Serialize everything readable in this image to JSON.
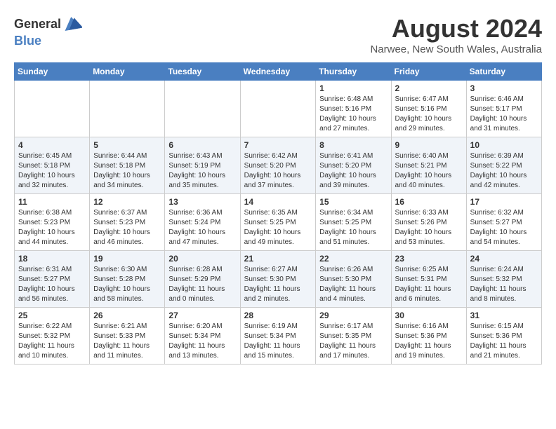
{
  "header": {
    "logo_general": "General",
    "logo_blue": "Blue",
    "month_year": "August 2024",
    "location": "Narwee, New South Wales, Australia"
  },
  "days_of_week": [
    "Sunday",
    "Monday",
    "Tuesday",
    "Wednesday",
    "Thursday",
    "Friday",
    "Saturday"
  ],
  "weeks": [
    [
      {
        "day": "",
        "info": ""
      },
      {
        "day": "",
        "info": ""
      },
      {
        "day": "",
        "info": ""
      },
      {
        "day": "",
        "info": ""
      },
      {
        "day": "1",
        "info": "Sunrise: 6:48 AM\nSunset: 5:16 PM\nDaylight: 10 hours\nand 27 minutes."
      },
      {
        "day": "2",
        "info": "Sunrise: 6:47 AM\nSunset: 5:16 PM\nDaylight: 10 hours\nand 29 minutes."
      },
      {
        "day": "3",
        "info": "Sunrise: 6:46 AM\nSunset: 5:17 PM\nDaylight: 10 hours\nand 31 minutes."
      }
    ],
    [
      {
        "day": "4",
        "info": "Sunrise: 6:45 AM\nSunset: 5:18 PM\nDaylight: 10 hours\nand 32 minutes."
      },
      {
        "day": "5",
        "info": "Sunrise: 6:44 AM\nSunset: 5:18 PM\nDaylight: 10 hours\nand 34 minutes."
      },
      {
        "day": "6",
        "info": "Sunrise: 6:43 AM\nSunset: 5:19 PM\nDaylight: 10 hours\nand 35 minutes."
      },
      {
        "day": "7",
        "info": "Sunrise: 6:42 AM\nSunset: 5:20 PM\nDaylight: 10 hours\nand 37 minutes."
      },
      {
        "day": "8",
        "info": "Sunrise: 6:41 AM\nSunset: 5:20 PM\nDaylight: 10 hours\nand 39 minutes."
      },
      {
        "day": "9",
        "info": "Sunrise: 6:40 AM\nSunset: 5:21 PM\nDaylight: 10 hours\nand 40 minutes."
      },
      {
        "day": "10",
        "info": "Sunrise: 6:39 AM\nSunset: 5:22 PM\nDaylight: 10 hours\nand 42 minutes."
      }
    ],
    [
      {
        "day": "11",
        "info": "Sunrise: 6:38 AM\nSunset: 5:23 PM\nDaylight: 10 hours\nand 44 minutes."
      },
      {
        "day": "12",
        "info": "Sunrise: 6:37 AM\nSunset: 5:23 PM\nDaylight: 10 hours\nand 46 minutes."
      },
      {
        "day": "13",
        "info": "Sunrise: 6:36 AM\nSunset: 5:24 PM\nDaylight: 10 hours\nand 47 minutes."
      },
      {
        "day": "14",
        "info": "Sunrise: 6:35 AM\nSunset: 5:25 PM\nDaylight: 10 hours\nand 49 minutes."
      },
      {
        "day": "15",
        "info": "Sunrise: 6:34 AM\nSunset: 5:25 PM\nDaylight: 10 hours\nand 51 minutes."
      },
      {
        "day": "16",
        "info": "Sunrise: 6:33 AM\nSunset: 5:26 PM\nDaylight: 10 hours\nand 53 minutes."
      },
      {
        "day": "17",
        "info": "Sunrise: 6:32 AM\nSunset: 5:27 PM\nDaylight: 10 hours\nand 54 minutes."
      }
    ],
    [
      {
        "day": "18",
        "info": "Sunrise: 6:31 AM\nSunset: 5:27 PM\nDaylight: 10 hours\nand 56 minutes."
      },
      {
        "day": "19",
        "info": "Sunrise: 6:30 AM\nSunset: 5:28 PM\nDaylight: 10 hours\nand 58 minutes."
      },
      {
        "day": "20",
        "info": "Sunrise: 6:28 AM\nSunset: 5:29 PM\nDaylight: 11 hours\nand 0 minutes."
      },
      {
        "day": "21",
        "info": "Sunrise: 6:27 AM\nSunset: 5:30 PM\nDaylight: 11 hours\nand 2 minutes."
      },
      {
        "day": "22",
        "info": "Sunrise: 6:26 AM\nSunset: 5:30 PM\nDaylight: 11 hours\nand 4 minutes."
      },
      {
        "day": "23",
        "info": "Sunrise: 6:25 AM\nSunset: 5:31 PM\nDaylight: 11 hours\nand 6 minutes."
      },
      {
        "day": "24",
        "info": "Sunrise: 6:24 AM\nSunset: 5:32 PM\nDaylight: 11 hours\nand 8 minutes."
      }
    ],
    [
      {
        "day": "25",
        "info": "Sunrise: 6:22 AM\nSunset: 5:32 PM\nDaylight: 11 hours\nand 10 minutes."
      },
      {
        "day": "26",
        "info": "Sunrise: 6:21 AM\nSunset: 5:33 PM\nDaylight: 11 hours\nand 11 minutes."
      },
      {
        "day": "27",
        "info": "Sunrise: 6:20 AM\nSunset: 5:34 PM\nDaylight: 11 hours\nand 13 minutes."
      },
      {
        "day": "28",
        "info": "Sunrise: 6:19 AM\nSunset: 5:34 PM\nDaylight: 11 hours\nand 15 minutes."
      },
      {
        "day": "29",
        "info": "Sunrise: 6:17 AM\nSunset: 5:35 PM\nDaylight: 11 hours\nand 17 minutes."
      },
      {
        "day": "30",
        "info": "Sunrise: 6:16 AM\nSunset: 5:36 PM\nDaylight: 11 hours\nand 19 minutes."
      },
      {
        "day": "31",
        "info": "Sunrise: 6:15 AM\nSunset: 5:36 PM\nDaylight: 11 hours\nand 21 minutes."
      }
    ]
  ]
}
